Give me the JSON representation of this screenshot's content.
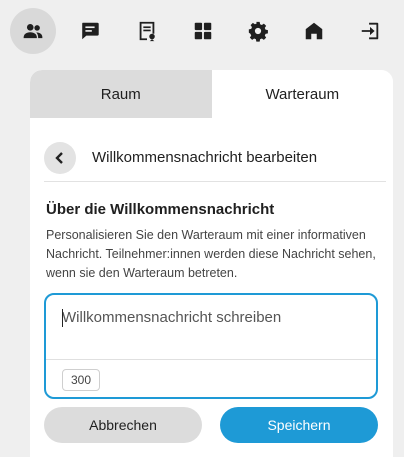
{
  "nav": {
    "items": [
      {
        "icon": "participants-icon",
        "active": true
      },
      {
        "icon": "chat-icon",
        "active": false
      },
      {
        "icon": "shared-notes-icon",
        "active": false
      },
      {
        "icon": "apps-grid-icon",
        "active": false
      },
      {
        "icon": "settings-gear-icon",
        "active": false
      },
      {
        "icon": "home-icon",
        "active": false
      },
      {
        "icon": "leave-exit-icon",
        "active": false
      }
    ]
  },
  "tabs": [
    {
      "label": "Raum",
      "active": false
    },
    {
      "label": "Warteraum",
      "active": true
    }
  ],
  "header": {
    "title": "Willkommensnachricht bearbeiten"
  },
  "section": {
    "title": "Über die Willkommensnachricht",
    "description": "Personalisieren Sie den Warteraum mit einer informativen Nachricht. Teilnehmer:innen werden diese Nachricht sehen, wenn sie den Warteraum betreten."
  },
  "message": {
    "placeholder": "Willkommensnachricht schreiben",
    "value": "",
    "char_limit": "300"
  },
  "buttons": {
    "cancel": "Abbrechen",
    "save": "Speichern"
  },
  "colors": {
    "accent": "#1e9ad6",
    "background": "#efefef",
    "tab_inactive": "#dcdcdc"
  }
}
